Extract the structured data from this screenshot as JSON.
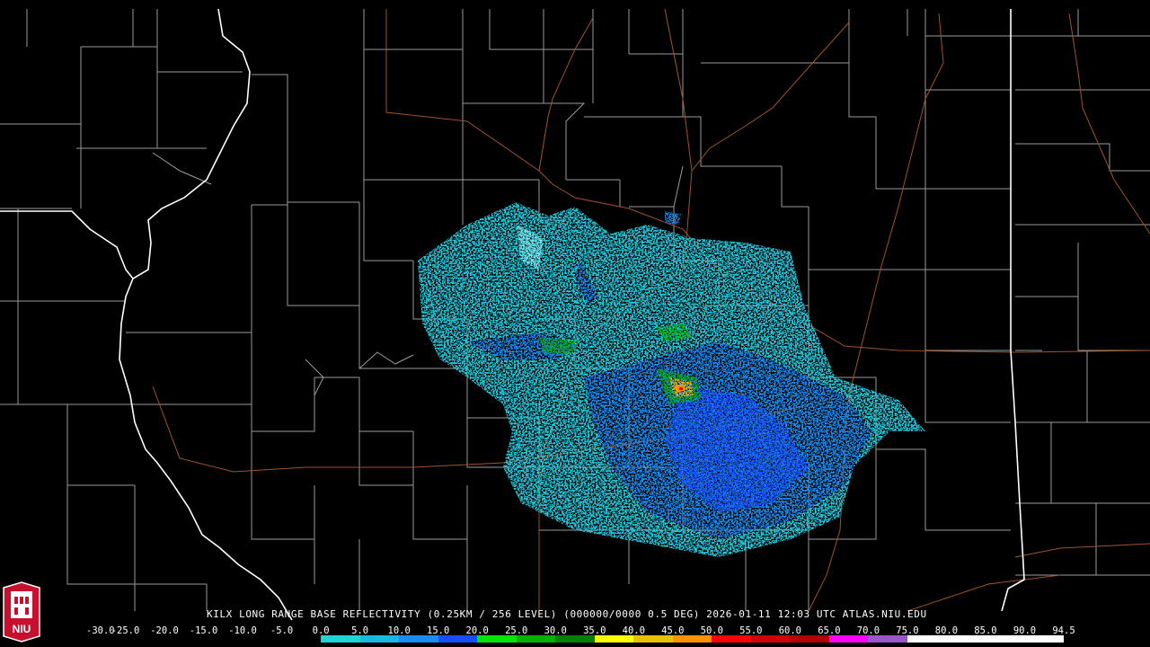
{
  "caption": "KILX LONG RANGE BASE REFLECTIVITY (0.25KM / 256 LEVEL) (000000/0000 0.5 DEG) 2026-01-11 12:03 UTC  ATLAS.NIU.EDU",
  "logo": {
    "text": "NIU"
  },
  "colorbar": {
    "labels": [
      "-30.0",
      "-25.0",
      "-20.0",
      "-15.0",
      "-10.0",
      "-5.0",
      "0.0",
      "5.0",
      "10.0",
      "15.0",
      "20.0",
      "25.0",
      "30.0",
      "35.0",
      "40.0",
      "45.0",
      "50.0",
      "55.0",
      "60.0",
      "65.0",
      "70.0",
      "75.0",
      "80.0",
      "85.0",
      "90.0",
      "94.5"
    ],
    "colors": [
      "#000000",
      "#000000",
      "#000000",
      "#000000",
      "#000000",
      "#000000",
      "#1fd4d4",
      "#18b8e0",
      "#1a8cf0",
      "#1450ff",
      "#00e400",
      "#00b000",
      "#008000",
      "#ffff00",
      "#e8c000",
      "#ff9000",
      "#ff0000",
      "#d00000",
      "#b00000",
      "#ff00ff",
      "#9955c9",
      "#ffffff",
      "#ffffff",
      "#ffffff",
      "#ffffff"
    ]
  },
  "colors": {
    "state_border": "#ffffff",
    "county_border": "#9a9a9a",
    "highway": "#a0522d",
    "background": "#000000"
  }
}
